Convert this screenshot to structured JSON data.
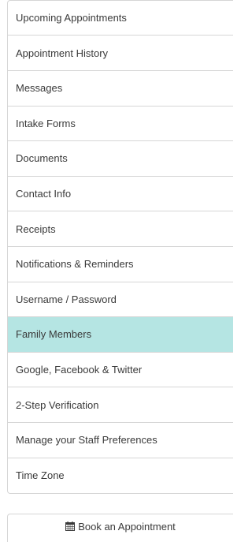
{
  "menu": {
    "group1": [
      {
        "label": "Upcoming Appointments"
      },
      {
        "label": "Appointment History"
      }
    ],
    "group2": [
      {
        "label": "Messages"
      },
      {
        "label": "Intake Forms"
      },
      {
        "label": "Documents"
      },
      {
        "label": "Contact Info"
      },
      {
        "label": "Receipts"
      },
      {
        "label": "Notifications & Reminders"
      },
      {
        "label": "Username / Password"
      },
      {
        "label": "Family Members",
        "active": true
      },
      {
        "label": "Google, Facebook & Twitter"
      },
      {
        "label": "2-Step Verification"
      },
      {
        "label": "Manage your Staff Preferences"
      },
      {
        "label": "Time Zone"
      }
    ]
  },
  "book_button": {
    "icon": "calendar-icon",
    "label": "Book an Appointment"
  },
  "colors": {
    "active_bg": "#b5e5e3",
    "border": "#d6d6d6",
    "text": "#3a3a3a"
  }
}
